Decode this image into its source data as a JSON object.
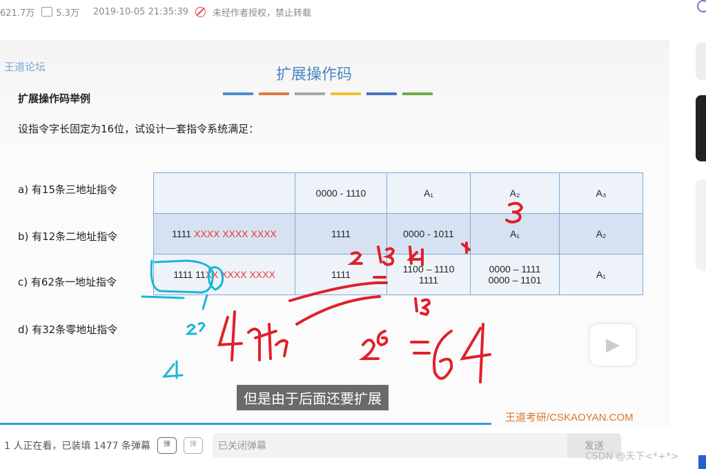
{
  "topbar": {
    "views": "621.7万",
    "danmaku_count": "5.3万",
    "datetime": "2019-10-05 21:35:39",
    "copyright": "未经作者授权，禁止转载"
  },
  "slide": {
    "logo": "王道论坛",
    "title": "扩展操作码",
    "bar_colors": [
      "#4a8fd0",
      "#e07b39",
      "#a5a5a5",
      "#f2c12e",
      "#4472c4",
      "#6aad45"
    ],
    "heading": "扩展操作码举例",
    "description": "设指令字长固定为16位，试设计一套指令系统满足：",
    "labels": [
      "a) 有15条三地址指令",
      "b) 有12条二地址指令",
      "c) 有62条一地址指令",
      "d) 有32条零地址指令"
    ],
    "table": {
      "rows": [
        {
          "c1_plain": "",
          "c1_red": "",
          "c2": "0000 - 1110",
          "c3": "A₁",
          "c4": "A₂",
          "c5": "A₃"
        },
        {
          "c1_plain": "1111 ",
          "c1_red": "XXXX XXXX XXXX",
          "c2": "1111",
          "c3": "0000 - 1011",
          "c4": "A₁",
          "c5": "A₂"
        },
        {
          "c1_plain": "1111 11",
          "c1_red": "XX XXXX XXXX",
          "c2": "1111",
          "c3": "1100 – 1110\n1111",
          "c4": "0000 – 1111\n0000 – 1101",
          "c5": "A₁"
        }
      ]
    },
    "brand": "王道考研/CSKAOYAN.COM"
  },
  "subtitle": "但是由于后面还要扩展",
  "bottombar": {
    "viewers": "1 人正在看，已装填 1477 条弹幕",
    "danmu_on_label": "弹",
    "danmu_settings_label": "弹",
    "input_placeholder": "已关闭弹幕",
    "send_label": "发送"
  },
  "watermark": "CSDN @天下<*+*>"
}
